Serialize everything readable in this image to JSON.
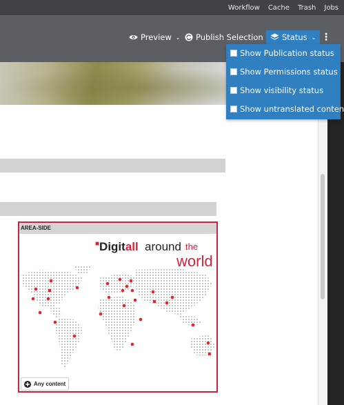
{
  "top_nav": {
    "items": [
      "Workflow",
      "Cache",
      "Trash",
      "Jobs"
    ]
  },
  "toolbar": {
    "preview_label": "Preview",
    "publish_label": "Publish Selection",
    "status_label": "Status",
    "status_color": "#2f7fc1"
  },
  "status_menu": {
    "items": [
      "Show Publication status",
      "Show Permissions status",
      "Show visibility status",
      "Show untranslated contents"
    ]
  },
  "area": {
    "label": "AREA-SIDE",
    "border_color": "#c6263d",
    "add_label": "Any content"
  },
  "logo": {
    "part1": "Digit",
    "part2": "all",
    "around": "around",
    "the": "the",
    "world": "world",
    "brand_color": "#d4243b"
  }
}
